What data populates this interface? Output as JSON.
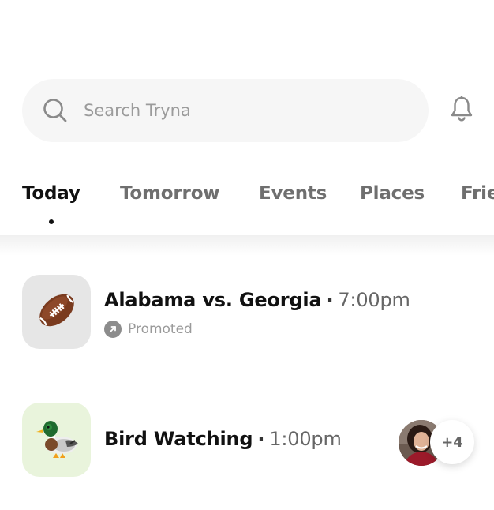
{
  "search": {
    "placeholder": "Search Tryna"
  },
  "tabs": [
    {
      "label": "Today",
      "active": true
    },
    {
      "label": "Tomorrow",
      "active": false
    },
    {
      "label": "Events",
      "active": false
    },
    {
      "label": "Places",
      "active": false
    },
    {
      "label": "Frie",
      "active": false
    }
  ],
  "items": [
    {
      "title": "Alabama vs. Georgia",
      "separator": "·",
      "time": "7:00pm",
      "promoted_label": "Promoted",
      "icon": "football-icon",
      "thumb_color": "#e6e6e6"
    },
    {
      "title": "Bird Watching",
      "separator": "·",
      "time": "1:00pm",
      "icon": "duck-icon",
      "thumb_color": "#e9f4dc",
      "more_count": "+4"
    }
  ],
  "colors": {
    "accent": "#111111",
    "muted": "#6f6f6f",
    "search_bg": "#f6f6f6"
  }
}
